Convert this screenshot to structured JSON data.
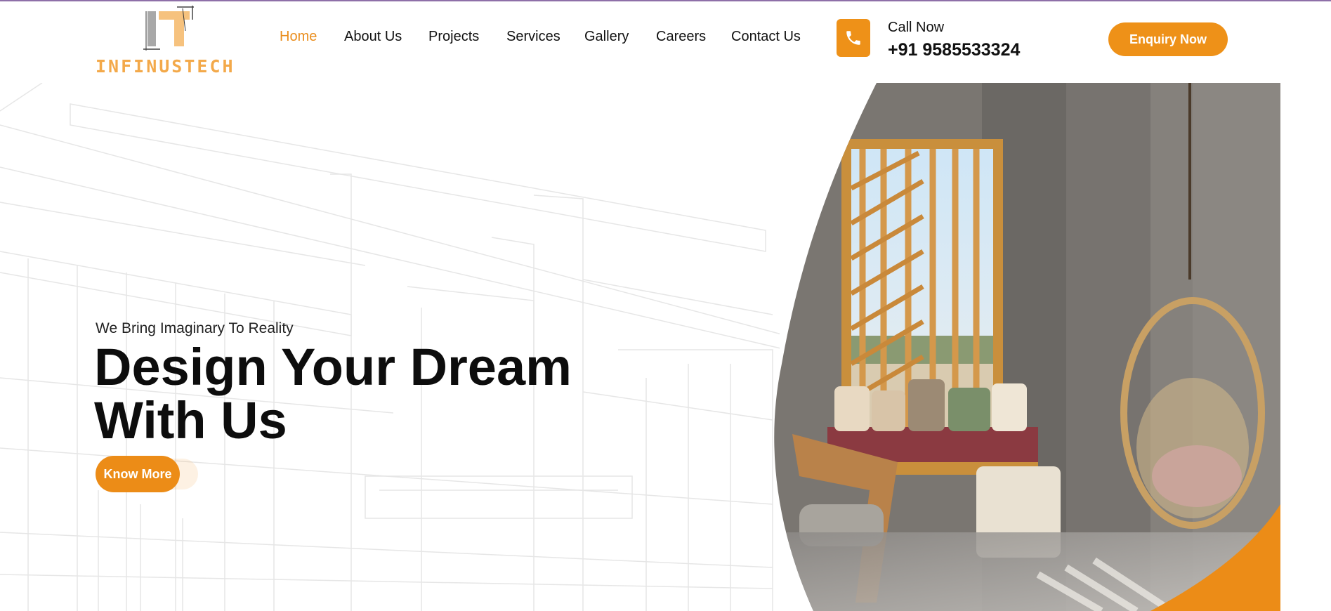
{
  "brand": {
    "name": "INFINUSTECH",
    "accent": "#ee9118"
  },
  "nav": {
    "items": [
      {
        "label": "Home",
        "active": true
      },
      {
        "label": "About Us",
        "active": false
      },
      {
        "label": "Projects",
        "active": false
      },
      {
        "label": "Services",
        "active": false
      },
      {
        "label": "Gallery",
        "active": false
      },
      {
        "label": "Careers",
        "active": false
      },
      {
        "label": "Contact Us",
        "active": false
      }
    ]
  },
  "contact": {
    "label": "Call Now",
    "phone": "+91 9585533324",
    "icon": "phone-icon"
  },
  "header": {
    "cta_label": "Enquiry Now"
  },
  "hero": {
    "tagline": "We Bring Imaginary To Reality",
    "headline_line1": "Design Your Dream",
    "headline_line2": "With Us",
    "cta_label": "Know More",
    "image": "interior-lounge-photo"
  }
}
